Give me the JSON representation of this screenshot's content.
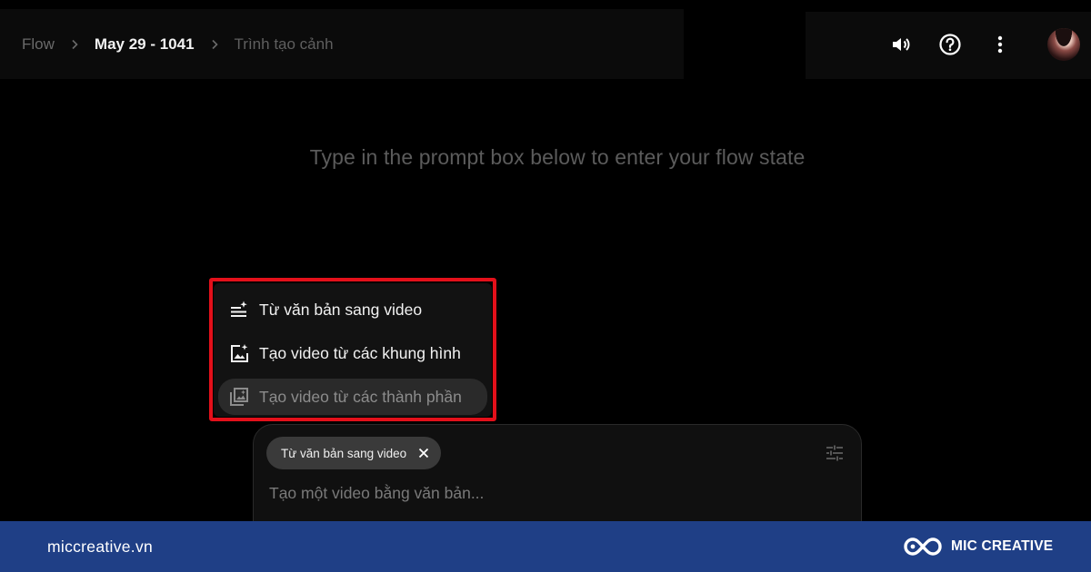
{
  "breadcrumb": {
    "root": "Flow",
    "project": "May 29 - 1041",
    "page": "Trình tạo cảnh"
  },
  "header_icons": [
    "volume-icon",
    "help-icon",
    "more-vert-icon"
  ],
  "main": {
    "headline": "Type in the prompt box below to enter your flow state"
  },
  "mode_menu": {
    "items": [
      {
        "label": "Từ văn bản sang video",
        "icon": "text-sparkle-icon"
      },
      {
        "label": "Tạo video từ các khung hình",
        "icon": "image-sparkle-icon"
      },
      {
        "label": "Tạo video từ các thành phần",
        "icon": "layers-sparkle-icon"
      }
    ]
  },
  "prompt_box": {
    "chip_label": "Từ văn bản sang video",
    "placeholder": "Tạo một video bằng văn bản..."
  },
  "footer": {
    "website": "miccreative.vn",
    "brand": "MIC CREATIVE"
  },
  "colors": {
    "highlight": "#e3101a",
    "footer_bg": "#1f3f86",
    "background": "#000000"
  }
}
